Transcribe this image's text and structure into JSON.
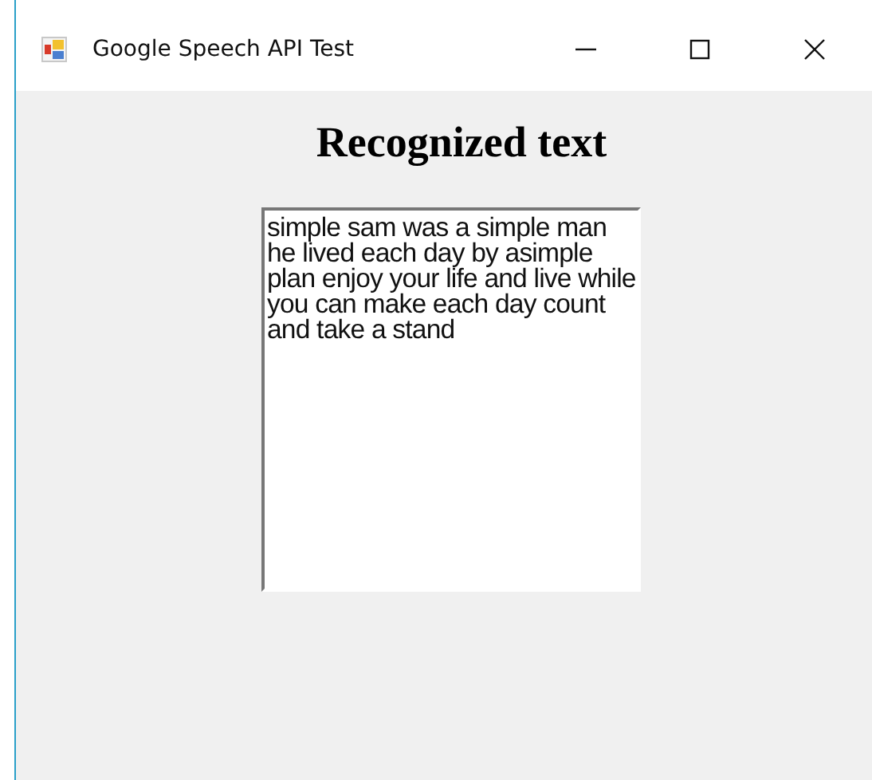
{
  "window": {
    "title": "Google Speech API Test"
  },
  "heading": "Recognized text",
  "text_box": {
    "value": "simple sam was a simple man he lived each day by asimple plan enjoy your life and live while you can make each day count and take a stand"
  }
}
